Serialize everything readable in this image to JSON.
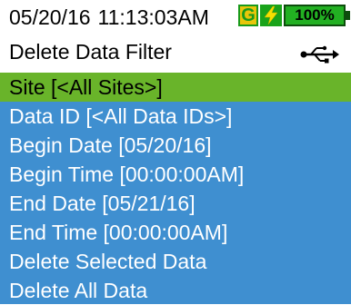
{
  "status_bar": {
    "date": "05/20/16",
    "time": "11:13:03AM",
    "gps_label": "G",
    "power_icon": "lightning-bolt-icon",
    "battery_label": "100%",
    "colors": {
      "gps_bg": "#e8c60a",
      "power_bg": "#1aa31a",
      "battery_fill": "#22b022"
    }
  },
  "header": {
    "title": "Delete Data Filter",
    "usb_icon": "usb-icon"
  },
  "menu": {
    "items": [
      {
        "label": "Site [<All Sites>]",
        "selected": true
      },
      {
        "label": "Data ID [<All Data IDs>]",
        "selected": false
      },
      {
        "label": "Begin Date [05/20/16]",
        "selected": false
      },
      {
        "label": "Begin Time [00:00:00AM]",
        "selected": false
      },
      {
        "label": "End Date [05/21/16]",
        "selected": false
      },
      {
        "label": "End Time [00:00:00AM]",
        "selected": false
      },
      {
        "label": "Delete Selected Data",
        "selected": false
      },
      {
        "label": "Delete All Data",
        "selected": false
      }
    ],
    "colors": {
      "background": "#3f8fd0",
      "selected_background": "#69b42a"
    }
  }
}
